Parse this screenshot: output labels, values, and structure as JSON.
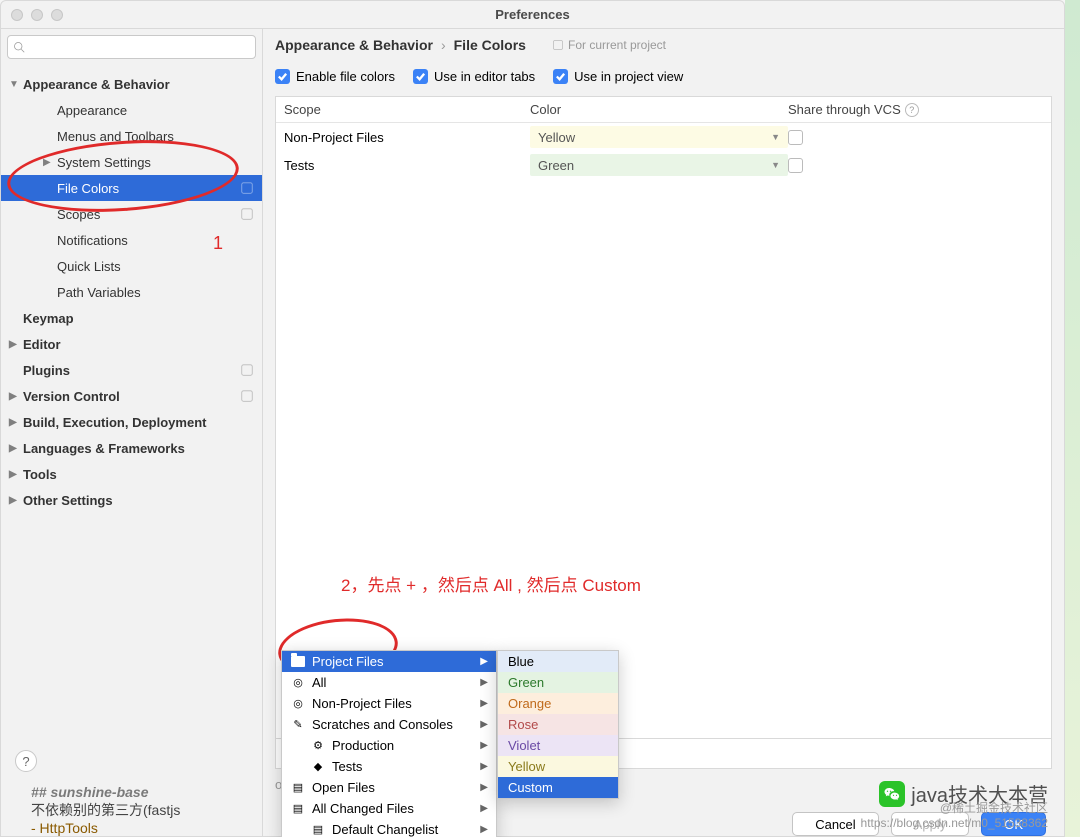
{
  "title": "Preferences",
  "search_placeholder": "",
  "sidebar": {
    "items": [
      {
        "label": "Appearance & Behavior",
        "bold": true,
        "arrow": "▼"
      },
      {
        "label": "Appearance",
        "child": true
      },
      {
        "label": "Menus and Toolbars",
        "child": true
      },
      {
        "label": "System Settings",
        "child": true,
        "arrow": "▶"
      },
      {
        "label": "File Colors",
        "child": true,
        "selected": true,
        "badge": true
      },
      {
        "label": "Scopes",
        "child": true,
        "badge": true
      },
      {
        "label": "Notifications",
        "child": true
      },
      {
        "label": "Quick Lists",
        "child": true
      },
      {
        "label": "Path Variables",
        "child": true
      },
      {
        "label": "Keymap",
        "bold": true
      },
      {
        "label": "Editor",
        "bold": true,
        "arrow": "▶"
      },
      {
        "label": "Plugins",
        "bold": true,
        "badge": true
      },
      {
        "label": "Version Control",
        "bold": true,
        "arrow": "▶",
        "badge": true
      },
      {
        "label": "Build, Execution, Deployment",
        "bold": true,
        "arrow": "▶"
      },
      {
        "label": "Languages & Frameworks",
        "bold": true,
        "arrow": "▶"
      },
      {
        "label": "Tools",
        "bold": true,
        "arrow": "▶"
      },
      {
        "label": "Other Settings",
        "bold": true,
        "arrow": "▶"
      }
    ]
  },
  "breadcrumb": {
    "a": "Appearance & Behavior",
    "b": "File Colors",
    "proj": "For current project"
  },
  "checks": {
    "a": "Enable file colors",
    "b": "Use in editor tabs",
    "c": "Use in project view"
  },
  "table": {
    "h1": "Scope",
    "h2": "Color",
    "h3": "Share through VCS",
    "rows": [
      {
        "scope": "Non-Project Files",
        "color": "Yellow",
        "cls": "yellow-bg"
      },
      {
        "scope": "Tests",
        "color": "Green",
        "cls": "green-bg"
      }
    ]
  },
  "hint": "or one",
  "buttons": {
    "cancel": "Cancel",
    "apply": "Apply",
    "ok": "OK"
  },
  "annot1_label": "1",
  "annot2_label": "2，先点 + ，然后点 All , 然后点 Custom",
  "scope_menu": [
    {
      "label": "Project Files",
      "sel": true,
      "icon": "folder"
    },
    {
      "label": "All",
      "icon": "target"
    },
    {
      "label": "Non-Project Files",
      "icon": "target"
    },
    {
      "label": "Scratches and Consoles",
      "icon": "scratch"
    },
    {
      "label": "Production",
      "indent": true,
      "icon": "gear"
    },
    {
      "label": "Tests",
      "indent": true,
      "icon": "diamond"
    },
    {
      "label": "Open Files",
      "icon": "doc"
    },
    {
      "label": "All Changed Files",
      "icon": "doc"
    },
    {
      "label": "Default Changelist",
      "indent": true,
      "icon": "doc"
    }
  ],
  "color_menu": [
    {
      "label": "Blue",
      "cls": "c-blue"
    },
    {
      "label": "Green",
      "cls": "c-green"
    },
    {
      "label": "Orange",
      "cls": "c-orange"
    },
    {
      "label": "Rose",
      "cls": "c-rose"
    },
    {
      "label": "Violet",
      "cls": "c-violet"
    },
    {
      "label": "Yellow",
      "cls": "c-yellow"
    },
    {
      "label": "Custom",
      "cls": "c-custom"
    }
  ],
  "footer_code": {
    "l1": "## sunshine-base",
    "l2": "不依赖别的第三方(fastjs",
    "l3": "- HttpTools"
  },
  "watermark": "java技术大本营",
  "watermark2a": "@稀土掘金技术社区",
  "watermark2b": "https://blog.csdn.net/m0_51538362"
}
